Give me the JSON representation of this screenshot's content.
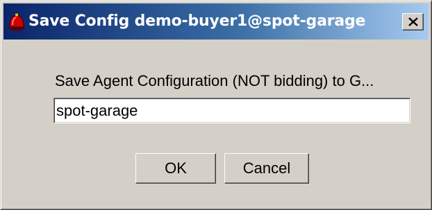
{
  "window": {
    "title": "Save Config demo-buyer1@spot-garage",
    "close_glyph": "✕"
  },
  "dialog": {
    "prompt": "Save Agent Configuration (NOT bidding) to G...",
    "name_field_value": "spot-garage",
    "ok_label": "OK",
    "cancel_label": "Cancel"
  },
  "icons": {
    "app": "red-bell-icon",
    "close": "close-icon"
  },
  "colors": {
    "titlebar_start": "#0a246a",
    "titlebar_end": "#a6caf0",
    "face": "#d4d0c8",
    "app_icon_red": "#cc0000"
  }
}
